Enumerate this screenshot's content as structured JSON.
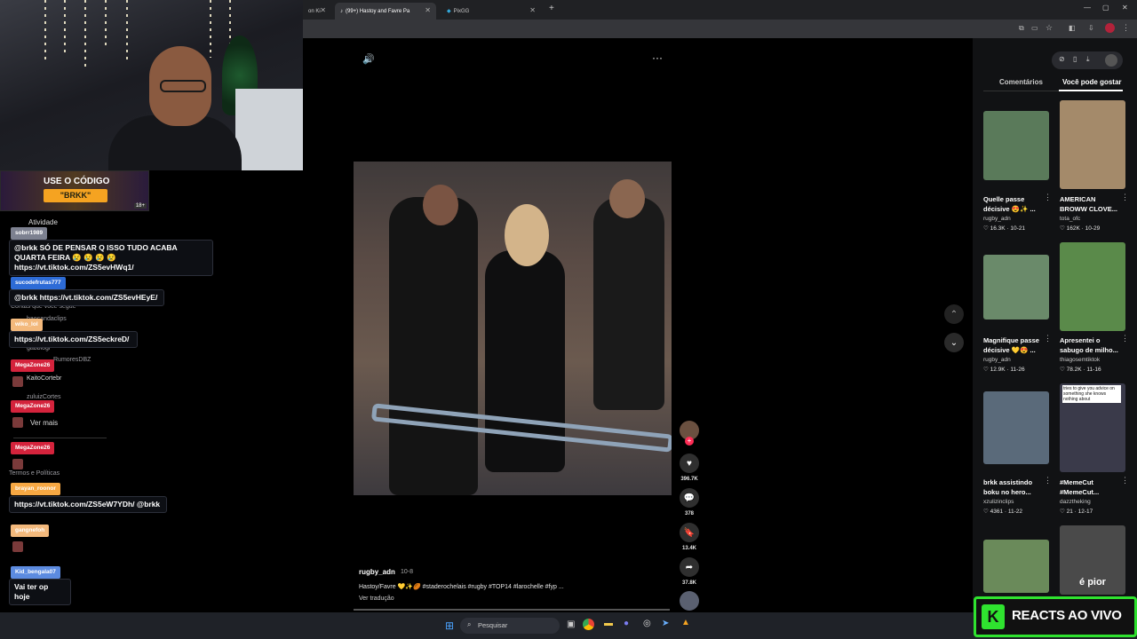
{
  "browser": {
    "tabs": [
      {
        "label": "on Ki",
        "active": false
      },
      {
        "label": "(99+) Hastoy and Favre Pa",
        "active": true
      },
      {
        "label": "PixGG",
        "active": false
      }
    ],
    "new_tab": "+"
  },
  "stream": {
    "promo_line1": "USE O CÓDIGO",
    "promo_line2": "\"BRKK\"",
    "promo_badge": "18+",
    "react_label": "REACTS AO VIVO",
    "react_logo": "K"
  },
  "sidebar_ghost": {
    "activity": "Atividade",
    "following": "Contas que você segue",
    "see_more": "Ver mais",
    "terms": "Termos e Políticas",
    "accounts": [
      "baocandaclips",
      "gabbiogi",
      "KaitoCortebr",
      "zuluizCortes",
      "RumoresDBZ"
    ]
  },
  "chat": [
    {
      "user": "sobrr1989",
      "user_color": "#9aa0b5",
      "text": "@brkk SÓ DE PENSAR Q ISSO TUDO ACABA QUARTA FEIRA 😢 😢 😢 😢 https://vt.tiktok.com/ZS5evHWq1/"
    },
    {
      "user": "sucodefrutas777",
      "user_color": "#2d6bd6",
      "text": "@brkk https://vt.tiktok.com/ZS5evHEyE/"
    },
    {
      "user": "wiko_lol",
      "user_color": "#f3b97c",
      "text": "https://vt.tiktok.com/ZS5eckreD/"
    },
    {
      "user": "MegaZone26",
      "user_color": "#d4233c",
      "text": ""
    },
    {
      "user": "MegaZone26",
      "user_color": "#d4233c",
      "text": ""
    },
    {
      "user": "MegaZone26",
      "user_color": "#d4233c",
      "text": ""
    },
    {
      "user": "brayan_roonor",
      "user_color": "#f7a843",
      "text": "https://vt.tiktok.com/ZS5eW7YDh/ @brkk"
    },
    {
      "user": "gangnefoh",
      "user_color": "#f3b97c",
      "text": ""
    },
    {
      "user": "Kid_bengala07",
      "user_color": "#5c8be0",
      "text": "Vai ter op hoje"
    }
  ],
  "video": {
    "author": "rugby_adn",
    "date": "10-8",
    "caption": "Hastoy/Favre 💛✨🏉 #staderochelais #rugby #TOP14 #larochelle #fyp ...",
    "translate": "Ver tradução",
    "likes": "396.7K",
    "comments": "378",
    "saves": "13.4K",
    "shares": "37.8K"
  },
  "right_panel": {
    "tab_comments": "Comentários",
    "tab_suggested": "Você pode gostar",
    "cards": [
      {
        "title": "Quelle passe décisive 😍✨ ...",
        "author": "rugby_adn",
        "likes": "16.3K",
        "date": "10-21",
        "thumb": "#5a7a5a"
      },
      {
        "title": "AMERICAN BROWW CLOVE...",
        "author": "tota_ofc",
        "likes": "162K",
        "date": "10-29",
        "thumb": "#a48a6a"
      },
      {
        "title": "Magnifique passe décisive 💛😍 ...",
        "author": "rugby_adn",
        "likes": "12.9K",
        "date": "11-26",
        "thumb": "#6a8a6a"
      },
      {
        "title": "Apresentei o sabugo de milho...",
        "author": "thiagosemtiktok",
        "likes": "78.2K",
        "date": "11-16",
        "thumb": "#5a8a4a"
      },
      {
        "title": "brkk assistindo boku no hero...",
        "author": "xzulizinclips",
        "likes": "4361",
        "date": "11-22",
        "thumb": "#5a6a7a"
      },
      {
        "title": "#MemeCut #MemeCut...",
        "author": "dazztheking",
        "likes": "21",
        "date": "12-17",
        "thumb": "#3a3a4a"
      },
      {
        "title": "",
        "author": "",
        "likes": "",
        "date": "",
        "thumb": "#6a8a5a"
      },
      {
        "title": "é pior",
        "author": "",
        "likes": "",
        "date": "",
        "thumb": "#4a4a4a"
      }
    ],
    "meme_overlay": "tries to give you advice on something she knows nothing about"
  },
  "taskbar": {
    "search_placeholder": "Pesquisar"
  }
}
